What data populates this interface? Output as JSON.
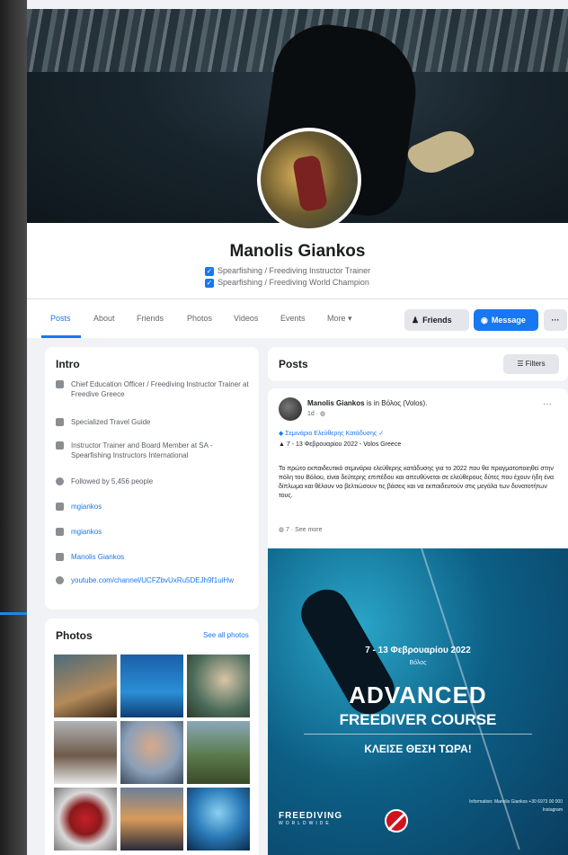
{
  "profile": {
    "name": "Manolis Giankos",
    "bio": [
      "Spearfishing / Freediving Instructor Trainer",
      "Spearfishing / Freediving World Champion"
    ]
  },
  "tabs": [
    "Posts",
    "About",
    "Friends",
    "Photos",
    "Videos",
    "Events",
    "More ▾"
  ],
  "buttons": {
    "friends": "Friends",
    "message": "Message",
    "more": "···"
  },
  "intro": {
    "title": "Intro",
    "items": [
      "Chief Education Officer / Freediving Instructor Trainer at Freedive Greece",
      "Specialized Travel Guide",
      "Instructor Trainer and Board Member at SA - Spearfishing Instructors International",
      "Followed by 5,456 people",
      "mgiankos",
      "mgiankos",
      "Manolis Giankos",
      "youtube.com/channel/UCFZbvUxRu5DEJh9f1uiHw"
    ]
  },
  "photos": {
    "title": "Photos",
    "see_all": "See all photos"
  },
  "posts": {
    "title": "Posts",
    "filters": "☰ Filters",
    "post": {
      "author": "Manolis Giankos",
      "location": "is in Βόλος (Volos).",
      "time": "1d · ◍",
      "line1": "◆ Σεμινάριο Ελεύθερης Κατάδυσης ✓",
      "line2": "▲ 7 - 13 Φεβρουαρίου 2022 - Volos Greece",
      "body": "Το πρώτο εκπαιδευτικό σεμινάριο ελεύθερης κατάδυσης για το 2022 που θα πραγματοποιηθεί στην πόλη του Βόλου, είναι δεύτερης επιπέδου και απευθύνεται σε ελεύθερους δύτες που έχουν ήδη ένα δίπλωμα και θέλουν να βελτιώσουν τις βάσεις και να εκπαιδευτούν στις μεγάλα των δυνατοτήτων τους.",
      "see_more": "◍ 7 · See more",
      "poster": {
        "date": "7 - 13 Φεβρουαρίου 2022",
        "city": "Βόλος",
        "title_1": "ADVANCED",
        "title_2": "FREEDIVER COURSE",
        "cta": "ΚΛΕΙΣΕ ΘΕΣΗ ΤΩΡΑ!",
        "logo_main": "FREEDIVING",
        "logo_sub": "WORLDWIDE",
        "info": "Information: Manolis Giankos +30 6973 00 000 Instagram"
      }
    }
  },
  "colors": {
    "accent": "#1877f2",
    "page_bg": "#f0f2f5",
    "card_bg": "#ffffff"
  }
}
